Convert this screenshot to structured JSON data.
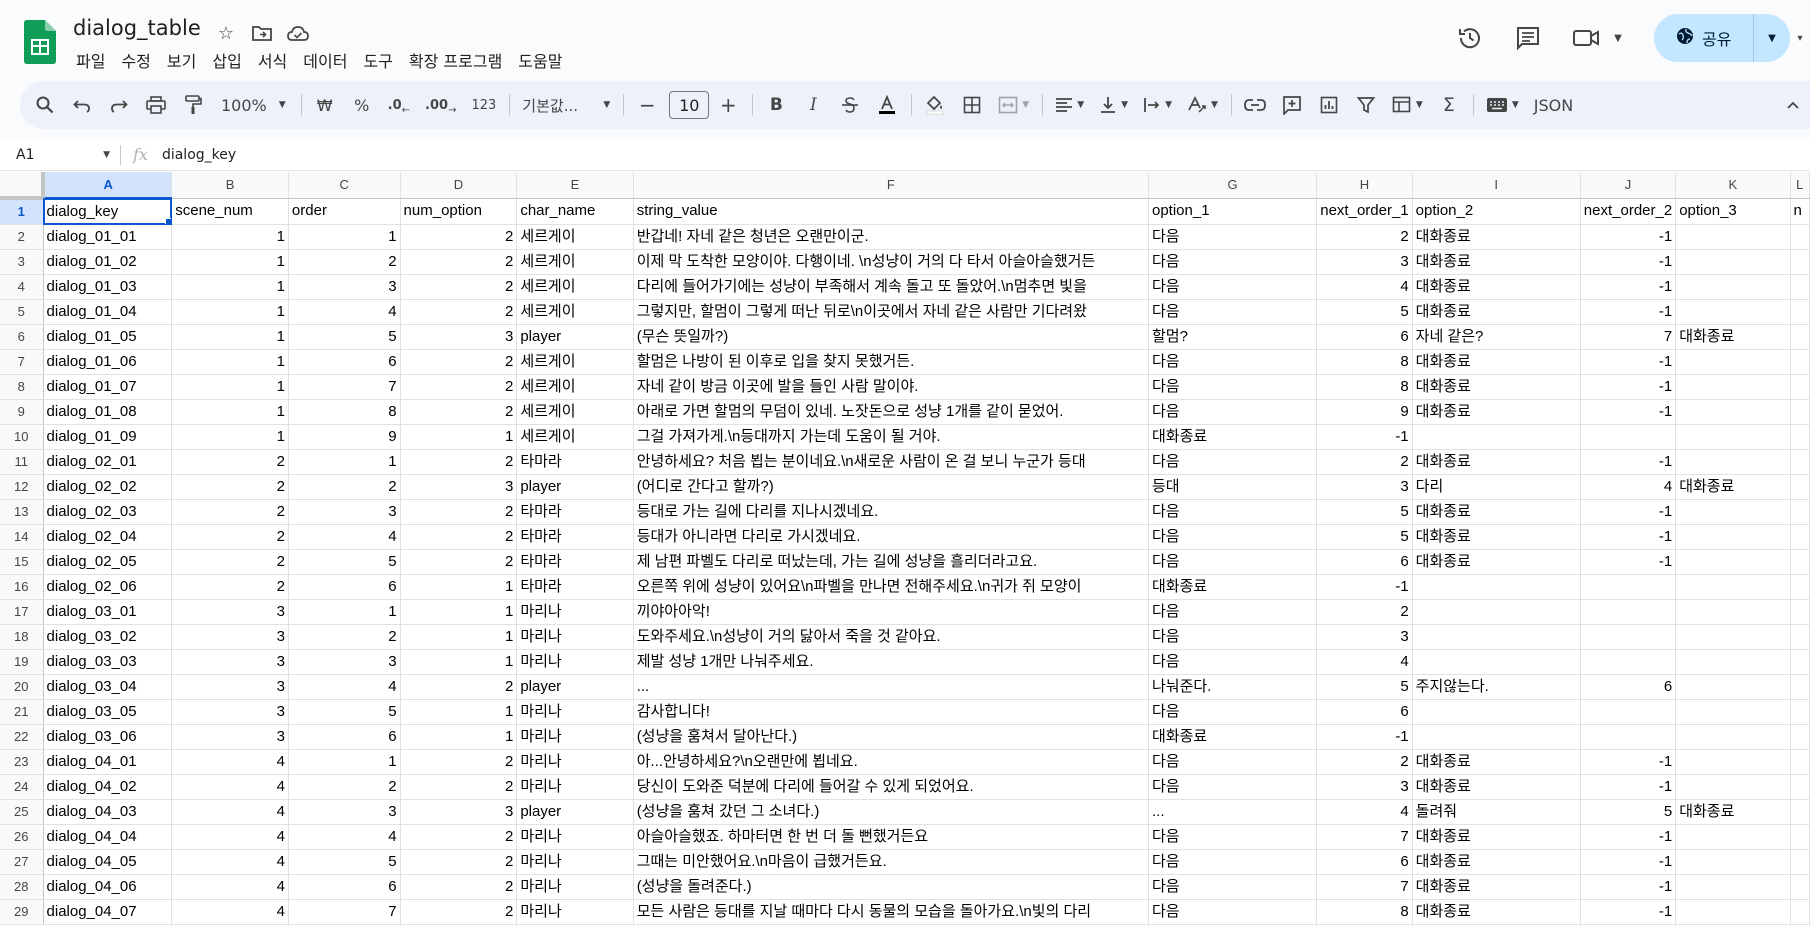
{
  "document": {
    "title": "dialog_table",
    "menu": [
      "파일",
      "수정",
      "보기",
      "삽입",
      "서식",
      "데이터",
      "도구",
      "확장 프로그램",
      "도움말"
    ],
    "share_label": "공유"
  },
  "toolbar": {
    "zoom": "100%",
    "currency": "₩",
    "percent": "%",
    "decrease_decimal": ".0",
    "increase_decimal": ".00",
    "number_format": "123",
    "font_name": "기본값...",
    "font_size": "10",
    "bold": "B",
    "italic": "I",
    "json_label": "JSON"
  },
  "formula_bar": {
    "cell_ref": "A1",
    "fx": "fx",
    "content": "dialog_key"
  },
  "grid": {
    "columns": [
      "A",
      "B",
      "C",
      "D",
      "E",
      "F",
      "G",
      "H",
      "I",
      "J",
      "K",
      "L"
    ],
    "rows": [
      [
        "dialog_key",
        "scene_num",
        "order",
        "num_option",
        "char_name",
        "string_value",
        "option_1",
        "next_order_1",
        "option_2",
        "next_order_2",
        "option_3",
        "n"
      ],
      [
        "dialog_01_01",
        "1",
        "1",
        "2",
        "세르게이",
        "반갑네! 자네 같은 청년은 오랜만이군.",
        "다음",
        "2",
        "대화종료",
        "-1",
        "",
        ""
      ],
      [
        "dialog_01_02",
        "1",
        "2",
        "2",
        "세르게이",
        "이제 막 도착한 모양이야. 다행이네. \\n성냥이 거의 다 타서 아슬아슬했거든",
        "다음",
        "3",
        "대화종료",
        "-1",
        "",
        ""
      ],
      [
        "dialog_01_03",
        "1",
        "3",
        "2",
        "세르게이",
        "다리에 들어가기에는 성냥이 부족해서 계속 돌고 또 돌았어.\\n멈추면 빛을",
        "다음",
        "4",
        "대화종료",
        "-1",
        "",
        ""
      ],
      [
        "dialog_01_04",
        "1",
        "4",
        "2",
        "세르게이",
        "그렇지만, 할멈이 그렇게 떠난 뒤로\\n이곳에서 자네 같은 사람만 기다려왔",
        "다음",
        "5",
        "대화종료",
        "-1",
        "",
        ""
      ],
      [
        "dialog_01_05",
        "1",
        "5",
        "3",
        "player",
        "(무슨 뜻일까?)",
        "할멈?",
        "6",
        "자네 같은?",
        "7",
        "대화종료",
        ""
      ],
      [
        "dialog_01_06",
        "1",
        "6",
        "2",
        "세르게이",
        "할멈은 나방이 된 이후로 입을 찾지 못했거든.",
        "다음",
        "8",
        "대화종료",
        "-1",
        "",
        ""
      ],
      [
        "dialog_01_07",
        "1",
        "7",
        "2",
        "세르게이",
        "자네 같이 방금 이곳에 발을 들인 사람 말이야.",
        "다음",
        "8",
        "대화종료",
        "-1",
        "",
        ""
      ],
      [
        "dialog_01_08",
        "1",
        "8",
        "2",
        "세르게이",
        "아래로 가면 할멈의 무덤이 있네. 노잣돈으로 성냥 1개를 같이 묻었어.",
        "다음",
        "9",
        "대화종료",
        "-1",
        "",
        ""
      ],
      [
        "dialog_01_09",
        "1",
        "9",
        "1",
        "세르게이",
        "그걸 가져가게.\\n등대까지 가는데 도움이 될 거야.",
        "대화종료",
        "-1",
        "",
        "",
        "",
        ""
      ],
      [
        "dialog_02_01",
        "2",
        "1",
        "2",
        "타마라",
        "안녕하세요? 처음 뵙는 분이네요.\\n새로운 사람이 온 걸 보니 누군가 등대",
        "다음",
        "2",
        "대화종료",
        "-1",
        "",
        ""
      ],
      [
        "dialog_02_02",
        "2",
        "2",
        "3",
        "player",
        "(어디로 간다고 할까?)",
        "등대",
        "3",
        "다리",
        "4",
        "대화종료",
        ""
      ],
      [
        "dialog_02_03",
        "2",
        "3",
        "2",
        "타마라",
        "등대로 가는 길에 다리를 지나시겠네요.",
        "다음",
        "5",
        "대화종료",
        "-1",
        "",
        ""
      ],
      [
        "dialog_02_04",
        "2",
        "4",
        "2",
        "타마라",
        "등대가 아니라면 다리로 가시겠네요.",
        "다음",
        "5",
        "대화종료",
        "-1",
        "",
        ""
      ],
      [
        "dialog_02_05",
        "2",
        "5",
        "2",
        "타마라",
        "제 남편 파벨도 다리로 떠났는데, 가는 길에 성냥을 흘리더라고요.",
        "다음",
        "6",
        "대화종료",
        "-1",
        "",
        ""
      ],
      [
        "dialog_02_06",
        "2",
        "6",
        "1",
        "타마라",
        "오른쪽 위에 성냥이 있어요\\n파벨을 만나면 전해주세요.\\n귀가 쥐 모양이",
        "대화종료",
        "-1",
        "",
        "",
        "",
        ""
      ],
      [
        "dialog_03_01",
        "3",
        "1",
        "1",
        "마리나",
        "끼야아아악!",
        "다음",
        "2",
        "",
        "",
        "",
        ""
      ],
      [
        "dialog_03_02",
        "3",
        "2",
        "1",
        "마리나",
        "도와주세요.\\n성냥이 거의 닳아서 죽을 것 같아요.",
        "다음",
        "3",
        "",
        "",
        "",
        ""
      ],
      [
        "dialog_03_03",
        "3",
        "3",
        "1",
        "마리나",
        "제발 성냥 1개만 나눠주세요.",
        "다음",
        "4",
        "",
        "",
        "",
        ""
      ],
      [
        "dialog_03_04",
        "3",
        "4",
        "2",
        "player",
        "...",
        "나눠준다.",
        "5",
        "주지않는다.",
        "6",
        "",
        ""
      ],
      [
        "dialog_03_05",
        "3",
        "5",
        "1",
        "마리나",
        "감사합니다!",
        "다음",
        "6",
        "",
        "",
        "",
        ""
      ],
      [
        "dialog_03_06",
        "3",
        "6",
        "1",
        "마리나",
        "(성냥을 훔쳐서 달아난다.)",
        "대화종료",
        "-1",
        "",
        "",
        "",
        ""
      ],
      [
        "dialog_04_01",
        "4",
        "1",
        "2",
        "마리나",
        "아...안녕하세요?\\n오랜만에 뵙네요.",
        "다음",
        "2",
        "대화종료",
        "-1",
        "",
        ""
      ],
      [
        "dialog_04_02",
        "4",
        "2",
        "2",
        "마리나",
        "당신이 도와준 덕분에 다리에 들어갈 수 있게 되었어요.",
        "다음",
        "3",
        "대화종료",
        "-1",
        "",
        ""
      ],
      [
        "dialog_04_03",
        "4",
        "3",
        "3",
        "player",
        "(성냥을 훔쳐 갔던 그 소녀다.)",
        "...",
        "4",
        "돌려줘",
        "5",
        "대화종료",
        ""
      ],
      [
        "dialog_04_04",
        "4",
        "4",
        "2",
        "마리나",
        "아슬아슬했죠. 하마터면 한 번 더 돌 뻔했거든요",
        "다음",
        "7",
        "대화종료",
        "-1",
        "",
        ""
      ],
      [
        "dialog_04_05",
        "4",
        "5",
        "2",
        "마리나",
        "그때는 미안했어요.\\n마음이 급했거든요.",
        "다음",
        "6",
        "대화종료",
        "-1",
        "",
        ""
      ],
      [
        "dialog_04_06",
        "4",
        "6",
        "2",
        "마리나",
        "(성냥을 돌려준다.)",
        "다음",
        "7",
        "대화종료",
        "-1",
        "",
        ""
      ],
      [
        "dialog_04_07",
        "4",
        "7",
        "2",
        "마리나",
        "모든 사람은 등대를 지날 때마다 다시 동물의 모습을 돌아가요.\\n빛의 다리",
        "다음",
        "8",
        "대화종료",
        "-1",
        "",
        ""
      ]
    ]
  },
  "colors": {
    "accent": "#0b57d0",
    "share_bg": "#c2e7ff",
    "logo_green": "#0f9d58"
  }
}
